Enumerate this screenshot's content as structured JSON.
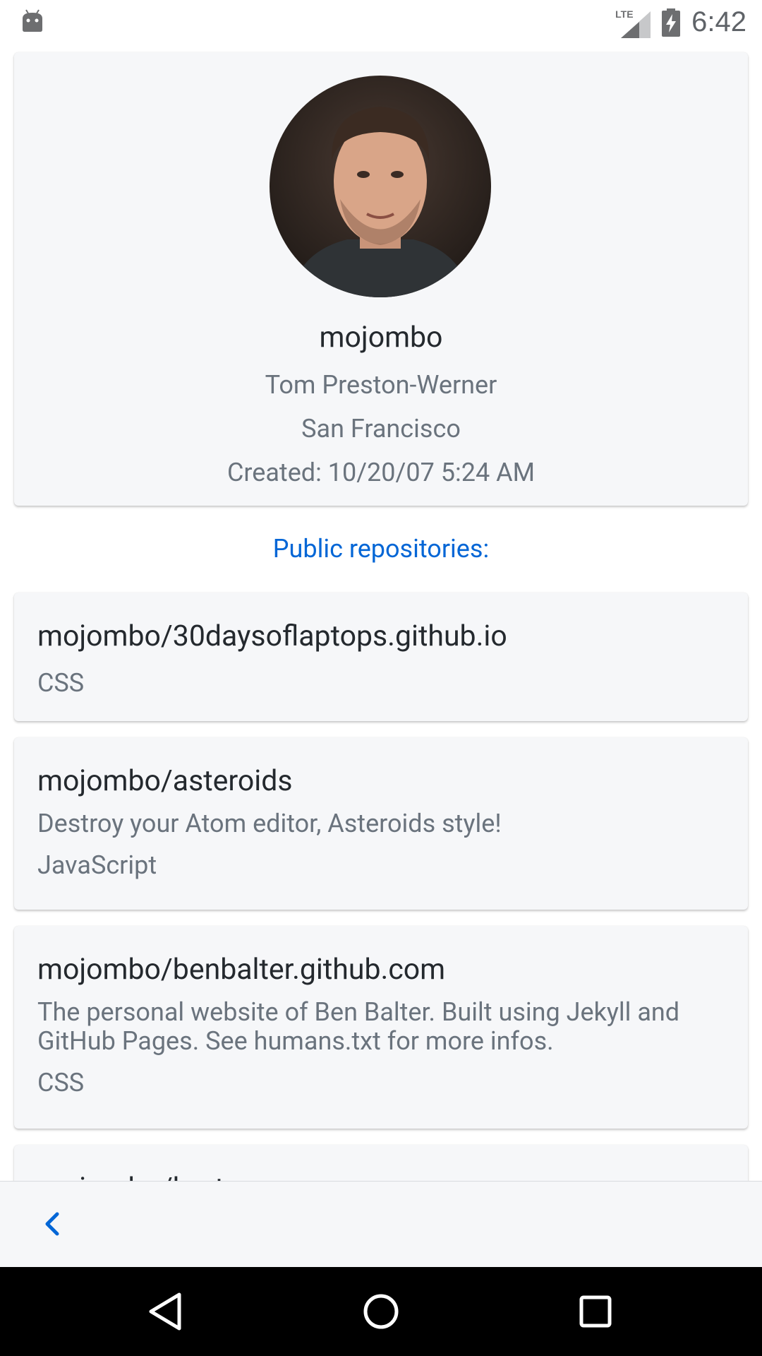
{
  "status_bar": {
    "time": "6:42",
    "network_label": "LTE",
    "icons": [
      "android-icon",
      "lte-signal-icon",
      "battery-charging-icon"
    ]
  },
  "profile": {
    "avatar_icon": "profile-photo",
    "username": "mojombo",
    "full_name": "Tom Preston-Werner",
    "location": "San Francisco",
    "created": "Created: 10/20/07 5:24 AM"
  },
  "repos_section": {
    "title": "Public repositories:"
  },
  "repos": [
    {
      "name": "mojombo/30daysoflaptops.github.io",
      "description": "",
      "language": "CSS"
    },
    {
      "name": "mojombo/asteroids",
      "description": "Destroy your Atom editor, Asteroids style!",
      "language": "JavaScript"
    },
    {
      "name": "mojombo/benbalter.github.com",
      "description": "The personal website of Ben Balter. Built using Jekyll and GitHub Pages. See humans.txt for more infos.",
      "language": "CSS"
    },
    {
      "name": "mojombo/bert",
      "description": "",
      "language": ""
    }
  ],
  "toolbar": {
    "back_icon": "chevron-left-icon"
  },
  "nav_bar": {
    "icons": [
      "nav-back-icon",
      "nav-home-icon",
      "nav-recents-icon"
    ]
  },
  "colors": {
    "accent": "#0366d6",
    "card_bg": "#f6f7f9",
    "primary_text": "#24292e",
    "secondary_text": "#6a737d"
  }
}
